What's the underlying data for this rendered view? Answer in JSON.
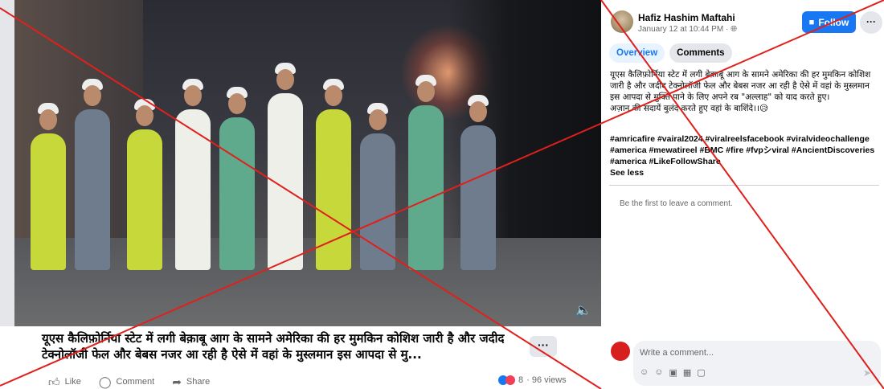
{
  "video": {
    "caption": "यूएस कैलिफ़ोर्निया स्टेट में लगी बेक़ाबू आग के सामने अमेरिका की हर मुमकिन कोशिश जारी है और जदीद टेक्नोलॉजी फेल और बेबस नजर आ रही है ऐसे में वहां के मुस्लमान इस आपदा से मु...",
    "more_label": "···",
    "volume_icon": "speaker-icon"
  },
  "actions": {
    "like_label": "Like",
    "comment_label": "Comment",
    "share_label": "Share"
  },
  "stats": {
    "reaction_count": "8",
    "views": "· 96 views"
  },
  "post": {
    "author": "Hafiz Hashim Maftahi",
    "timestamp": "January 12 at 10:44 PM ·",
    "follow_label": "Follow",
    "more_label": "···",
    "tabs": [
      {
        "label": "Overview"
      },
      {
        "label": "Comments"
      }
    ],
    "text_line1": "यूएस कैलिफ़ोर्निया स्टेट में लगी बेक़ाबू आग के सामने अमेरिका की हर मुमकिन कोशिश जारी है और जदीद टेक्नोलॉजी फेल और बेबस नजर आ रही है ऐसे में वहां के मुस्लमान इस आपदा से मुक्ति पाने के लिए अपने रब \"अल्लाह\" को याद करते हुए।",
    "text_line2": "अज़ान की सदायें बुलंद करते हुए वहां के बाशिंदे।।😥",
    "hashtags": "#amricafire #vairal2024 #viralreelsfacebook #viralvideochallenge #america #mewatireel #BMC #fire #fvpシviral #AncientDiscoveries #america #LikeFollowShare",
    "see_less": "See less",
    "first_comment": "Be the first to leave a comment.",
    "comment_placeholder": "Write a comment..."
  },
  "colors": {
    "accent": "#1877f2",
    "overlay_cross": "#e0201c"
  }
}
